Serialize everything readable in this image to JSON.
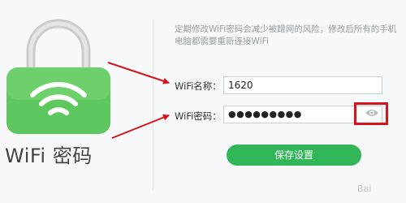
{
  "left_panel": {
    "caption": "WiFi 密码"
  },
  "notice": {
    "line1": "定期修改WiFi密码会减少被蹭网的风险，修改后所有的手机",
    "line2": "电脑都需要重新连接WiFi"
  },
  "form": {
    "name_label": "WiFi名称：",
    "name_value": "1620",
    "password_label": "WiFi密码：",
    "password_value": "●●●●●●●●●"
  },
  "save_button_label": "保存设置",
  "watermark": "Bai",
  "colors": {
    "accent": "#32b65a",
    "annotation": "#d8141a"
  },
  "icons": {
    "lock": "padlock-wifi-icon",
    "eye": "eye-icon"
  }
}
